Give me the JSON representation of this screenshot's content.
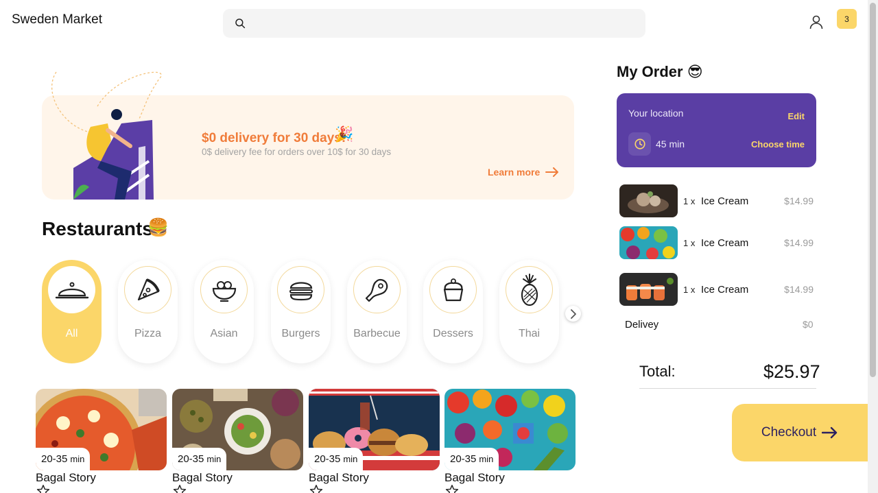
{
  "header": {
    "brand": "Sweden Market",
    "search_placeholder": "",
    "cart_count": "3"
  },
  "promo": {
    "title": "$0 delivery for 30 days!",
    "subtitle": "0$ delivery fee for orders over 10$ for 30 days",
    "cta": "Learn more"
  },
  "restaurants": {
    "title": "Restaurants",
    "categories": [
      {
        "label": "All",
        "icon": "cloche-icon",
        "active": true
      },
      {
        "label": "Pizza",
        "icon": "pizza-icon"
      },
      {
        "label": "Asian",
        "icon": "noodle-bowl-icon"
      },
      {
        "label": "Burgers",
        "icon": "burger-icon"
      },
      {
        "label": "Barbecue",
        "icon": "steak-icon"
      },
      {
        "label": "Dessers",
        "icon": "cupcake-icon"
      },
      {
        "label": "Thai",
        "icon": "pineapple-icon"
      }
    ],
    "cards": [
      {
        "time": "20-35",
        "unit": "min",
        "name": "Bagal Story",
        "photo": "pizza"
      },
      {
        "time": "20-35",
        "unit": "min",
        "name": "Bagal Story",
        "photo": "table-spread"
      },
      {
        "time": "20-35",
        "unit": "min",
        "name": "Bagal Story",
        "photo": "burgers-donuts"
      },
      {
        "time": "20-35",
        "unit": "min",
        "name": "Bagal Story",
        "photo": "vegetables"
      }
    ]
  },
  "order": {
    "title": "My Order",
    "location_label": "Your location",
    "edit": "Edit",
    "eta": "45 min",
    "choose_time": "Choose time",
    "items": [
      {
        "qty": "1 x",
        "name": "Ice Cream",
        "price": "$14.99",
        "photo": "dark-dessert"
      },
      {
        "qty": "1 x",
        "name": "Ice Cream",
        "price": "$14.99",
        "photo": "vegetables"
      },
      {
        "qty": "1 x",
        "name": "Ice Cream",
        "price": "$14.99",
        "photo": "sushi"
      }
    ],
    "delivery_label": "Delivey",
    "delivery_value": "$0",
    "total_label": "Total:",
    "total_value": "$25.97",
    "checkout": "Checkout"
  },
  "colors": {
    "accent_yellow": "#fbd669",
    "accent_orange": "#f07c3a",
    "location_purple": "#5a3ea4",
    "promo_bg": "#fff5ea"
  }
}
